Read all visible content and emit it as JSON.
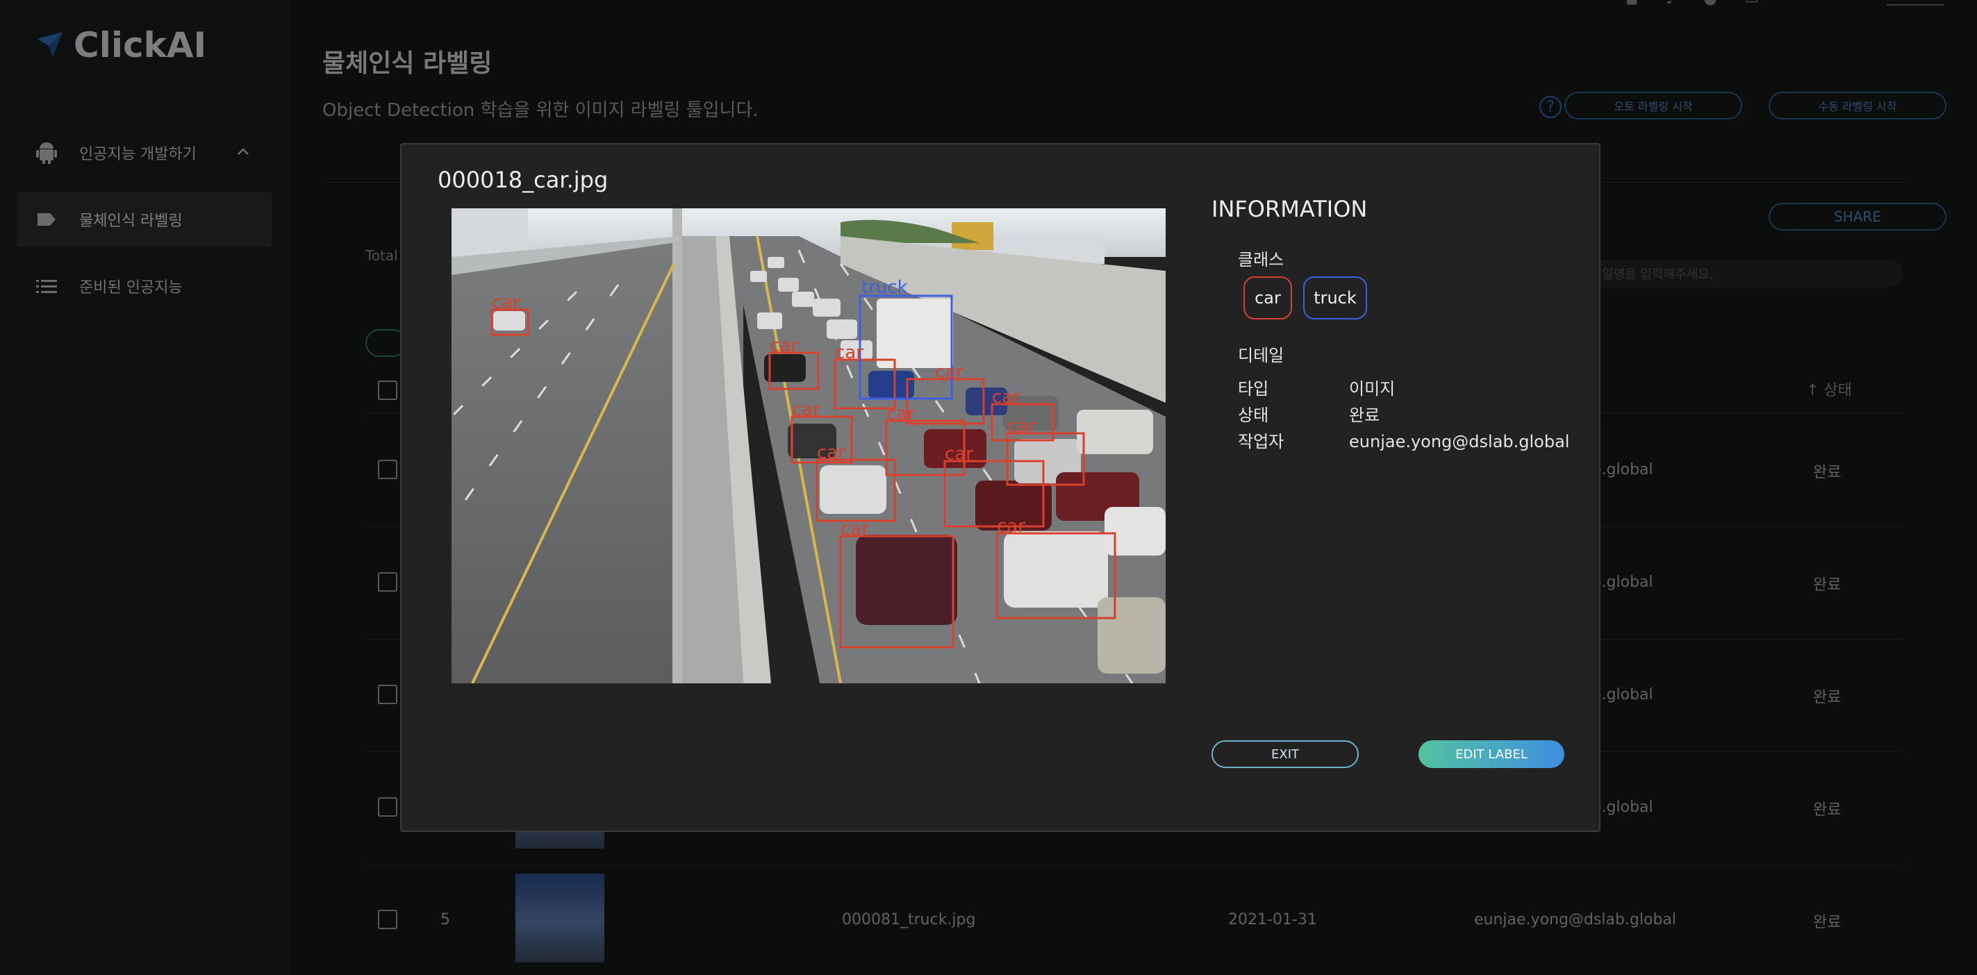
{
  "app": {
    "name": "ClickAI"
  },
  "sidebar": {
    "items": [
      {
        "label": "인공지능 개발하기",
        "icon": "android-icon"
      },
      {
        "label": "물체인식 라벨링",
        "icon": "label-tag-icon"
      },
      {
        "label": "준비된 인공지능",
        "icon": "list-icon"
      }
    ]
  },
  "page": {
    "title": "물체인식 라벨링",
    "subtitle": "Object Detection 학습을 위한 이미지 라벨링 툴입니다.",
    "auto_label_button": "오토 라벨링 시작",
    "manual_label_button": "수동 라벨링 시작",
    "share_button": "SHARE",
    "total_label": "Total",
    "search_placeholder": "일명을 입력해주세요.",
    "status_header": "상태"
  },
  "table": {
    "rows": [
      {
        "num": "",
        "file": "",
        "date": "",
        "worker": "lab.global",
        "status": "완료"
      },
      {
        "num": "",
        "file": "",
        "date": "",
        "worker": "lab.global",
        "status": "완료"
      },
      {
        "num": "",
        "file": "",
        "date": "",
        "worker": "lab.global",
        "status": "완료"
      },
      {
        "num": "",
        "file": "",
        "date": "",
        "worker": "lab.global",
        "status": "완료"
      },
      {
        "num": "5",
        "file": "000081_truck.jpg",
        "date": "2021-01-31",
        "worker": "eunjae.yong@dslab.global",
        "status": "완료"
      }
    ]
  },
  "modal": {
    "file_name": "000018_car.jpg",
    "info_title": "INFORMATION",
    "class_label": "클래스",
    "classes": [
      {
        "name": "car",
        "color": "#d9412f"
      },
      {
        "name": "truck",
        "color": "#3f5fe0"
      }
    ],
    "detail_label": "디테일",
    "details": [
      {
        "key": "타입",
        "value": "이미지"
      },
      {
        "key": "상태",
        "value": "완료"
      },
      {
        "key": "작업자",
        "value": "eunjae.yong@dslab.global"
      }
    ],
    "exit_button": "EXIT",
    "edit_button": "EDIT LABEL",
    "box_labels": {
      "car": "car",
      "truck": "truck"
    }
  },
  "colors": {
    "car_box": "#d9412f",
    "truck_box": "#3f5fe0",
    "accent_blue": "#2d6fb8"
  }
}
